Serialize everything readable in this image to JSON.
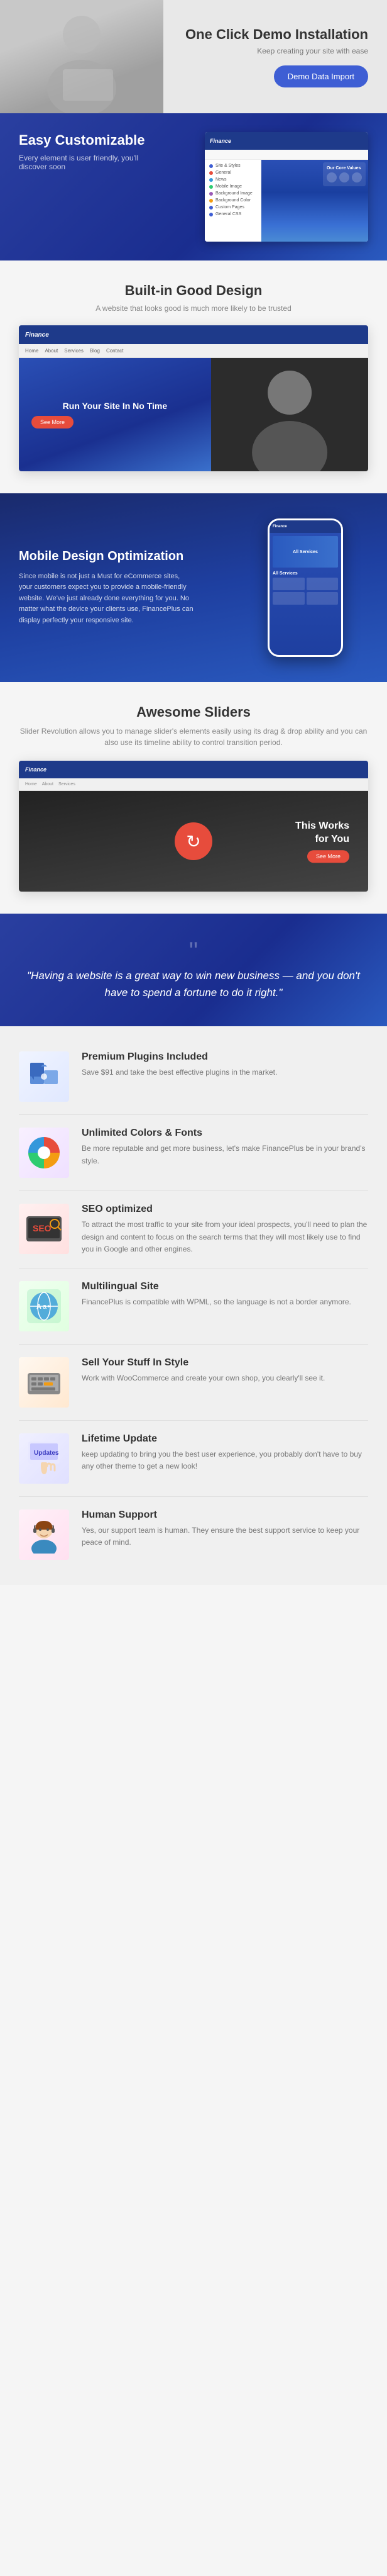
{
  "hero": {
    "title": "One Click Demo Installation",
    "subtitle": "Keep creating your site with ease",
    "button_label": "Demo Data Import"
  },
  "easy": {
    "title": "Easy Customizable",
    "subtitle": "Every element is user friendly, you'll discover soon",
    "brand": "Finance",
    "panel_title": "Our Core Values",
    "menu_items": [
      "Site & & Styles",
      "General",
      "News",
      "Mobile Image",
      "Background Image",
      "Background Color",
      "Custom Pages",
      "General CSS"
    ]
  },
  "design": {
    "title": "Built-in Good Design",
    "subtitle": "A website that looks good is much more likely to be trusted",
    "banner_text": "Run Your Site In No Time",
    "button_label": "See More"
  },
  "mobile": {
    "title": "Mobile Design Optimization",
    "description": "Since mobile is not just a Must for eCommerce sites, your customers expect you to provide a mobile-friendly website. We've just already done everything for you. No matter what the device your clients use, FinancePlus can display perfectly your responsive site.",
    "service_title": "All Services"
  },
  "sliders": {
    "title": "Awesome Sliders",
    "description": "Slider Revolution allows you to manage slider's elements easily using its drag & drop ability and you can also use its timeline ability to control transition period.",
    "overlay_line1": "This w___ for You",
    "overlay_btn": "See More"
  },
  "quote": {
    "text": "\"Having a website is a great way to win new business — and you don't have to spend a fortune to do it right.\""
  },
  "features": [
    {
      "id": "plugins",
      "title": "Premium Plugins Included",
      "description": "Save $91 and take the best effective plugins in the market.",
      "icon": "puzzle"
    },
    {
      "id": "colors",
      "title": "Unlimited Colors & Fonts",
      "description": "Be more reputable and get more business, let's make FinancePlus be in your brand's style.",
      "icon": "color-wheel"
    },
    {
      "id": "seo",
      "title": "SEO optimized",
      "description": "To attract the most traffic to your site from your ideal prospects, you'll need to plan the design and content to focus on the search terms that they will most likely use to find you in Google and other engines.",
      "icon": "seo"
    },
    {
      "id": "multilingual",
      "title": "Multilingual Site",
      "description": "FinancePlus is compatible with WPML, so the language is not a border anymore.",
      "icon": "translate"
    },
    {
      "id": "shop",
      "title": "Sell Your Stuff In Style",
      "description": "Work with WooCommerce and create your own shop, you clearly'll see it.",
      "icon": "shop"
    },
    {
      "id": "update",
      "title": "Lifetime Update",
      "description": "keep updating to bring you the best user experience, you probably don't have to buy any other theme to get a new look!",
      "icon": "news"
    },
    {
      "id": "support",
      "title": "Human Support",
      "description": "Yes, our support team is human. They ensure the best support service to keep your peace of mind.",
      "icon": "human"
    }
  ]
}
